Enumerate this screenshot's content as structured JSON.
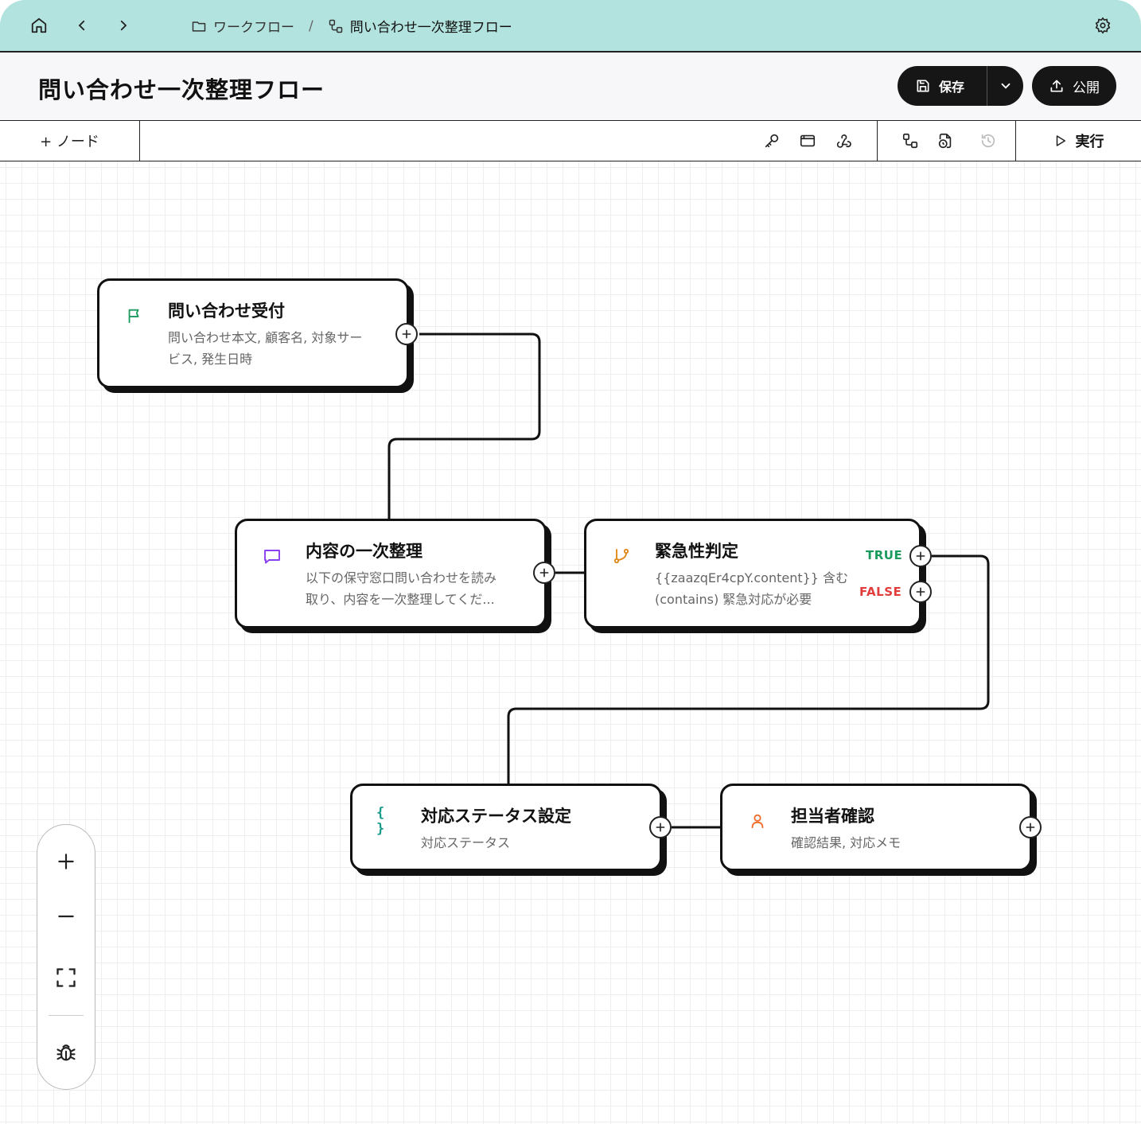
{
  "breadcrumb": {
    "workflows_label": "ワークフロー",
    "separator": "/",
    "current_label": "問い合わせ一次整理フロー"
  },
  "page": {
    "title": "問い合わせ一次整理フロー"
  },
  "actions": {
    "save_label": "保存",
    "publish_label": "公開"
  },
  "toolbar": {
    "add_node_label": "+ ノード",
    "run_label": "実行"
  },
  "nodes": {
    "intake": {
      "title": "問い合わせ受付",
      "desc_line1": "問い合わせ本文, 顧客名, 対象サー",
      "desc_line2": "ビス, 発生日時",
      "icon": "flag-icon"
    },
    "organize": {
      "title": "内容の一次整理",
      "desc_line1": "以下の保守窓口問い合わせを読み",
      "desc_line2": "取り、内容を一次整理してくだ...",
      "icon": "message-icon"
    },
    "urgency": {
      "title": "緊急性判定",
      "desc_line1": "{{zaazqEr4cpY.content}} 含む",
      "desc_line2": "(contains) 緊急対応が必要",
      "true_label": "TRUE",
      "false_label": "FALSE",
      "icon": "branch-icon"
    },
    "status": {
      "title": "対応ステータス設定",
      "desc_line1": "対応ステータス",
      "icon": "braces-icon"
    },
    "assignee": {
      "title": "担当者確認",
      "desc_line1": "確認結果, 対応メモ",
      "icon": "user-icon"
    }
  },
  "colors": {
    "topbar": "#b3e3de",
    "true": "#1a9a5c",
    "false": "#e23c3c",
    "flag": "#1a9a5c",
    "message": "#8a3ff0",
    "branch": "#e08a1c",
    "braces": "#1a9a8a",
    "user": "#ef6a2a"
  }
}
